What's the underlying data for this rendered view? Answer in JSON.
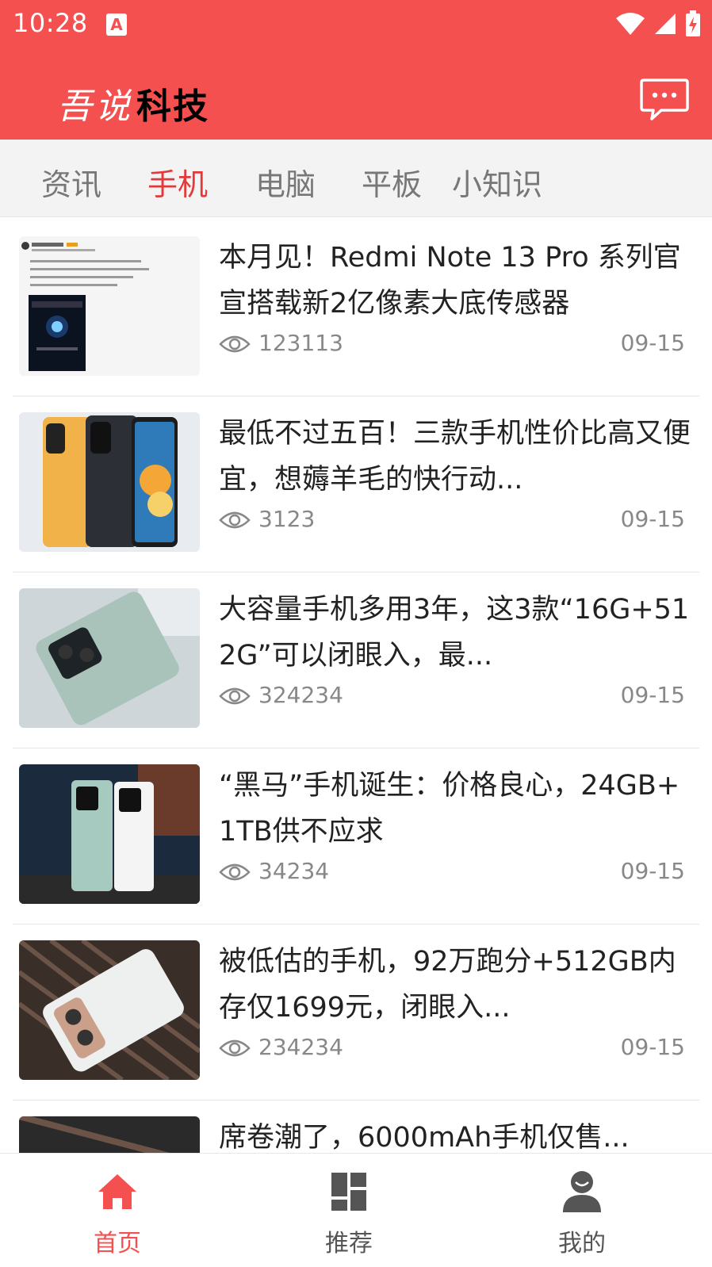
{
  "status_bar": {
    "time": "10:28",
    "notification_badge": "A"
  },
  "app": {
    "brand_part1": "吾说",
    "brand_part2": "科技",
    "accent_color": "#f45050",
    "chat_icon": "message-icon"
  },
  "tabs": [
    {
      "label": "资讯",
      "active": false
    },
    {
      "label": "手机",
      "active": true
    },
    {
      "label": "电脑",
      "active": false
    },
    {
      "label": "平板",
      "active": false
    },
    {
      "label": "小知识",
      "active": false
    }
  ],
  "articles": [
    {
      "title": "本月见！Redmi Note 13 Pro 系列官宣搭载新2亿像素大底传感器",
      "views": "123113",
      "date": "09-15"
    },
    {
      "title": "最低不过五百！三款手机性价比高又便宜，想薅羊毛的快行动...",
      "views": "3123",
      "date": "09-15"
    },
    {
      "title": "大容量手机多用3年，这3款“16G+512G”可以闭眼入，最...",
      "views": "324234",
      "date": "09-15"
    },
    {
      "title": "“黑马”手机诞生：价格良心，24GB+1TB供不应求",
      "views": "34234",
      "date": "09-15"
    },
    {
      "title": "被低估的手机，92万跑分+512GB内存仅1699元，闭眼入...",
      "views": "234234",
      "date": "09-15"
    },
    {
      "title": "席卷潮了，6000mAh手机仅售...",
      "views": "",
      "date": ""
    }
  ],
  "bottom_nav": [
    {
      "label": "首页",
      "icon": "home-icon",
      "active": true
    },
    {
      "label": "推荐",
      "icon": "grid-icon",
      "active": false
    },
    {
      "label": "我的",
      "icon": "user-icon",
      "active": false
    }
  ]
}
